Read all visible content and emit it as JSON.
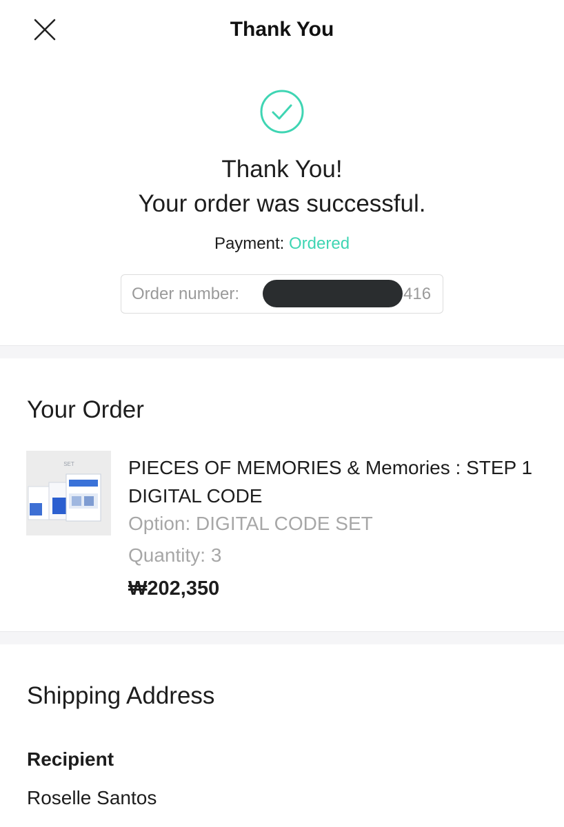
{
  "header": {
    "title": "Thank You",
    "close_icon": "close-icon"
  },
  "confirmation": {
    "icon": "check-circle-icon",
    "accent_color": "#3fd5b3",
    "line1": "Thank You!",
    "line2": "Your order was successful.",
    "payment_label": "Payment:",
    "payment_status": "Ordered",
    "order_number_label": "Order number:",
    "order_number_suffix": "416"
  },
  "your_order": {
    "title": "Your Order",
    "item": {
      "image_caption": "SET",
      "name": "PIECES OF MEMORIES & Memories : STEP 1 DIGITAL CODE",
      "option": "Option: DIGITAL CODE SET",
      "quantity": "Quantity: 3",
      "price": "₩202,350"
    }
  },
  "shipping": {
    "title": "Shipping Address",
    "recipient_label": "Recipient",
    "recipient_name": "Roselle Santos"
  }
}
